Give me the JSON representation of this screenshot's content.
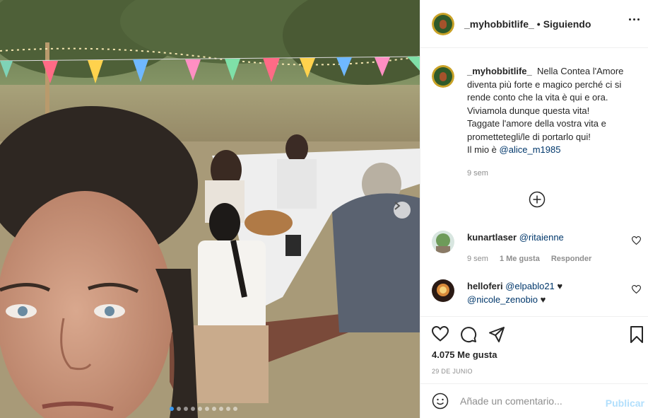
{
  "post": {
    "username": "_myhobbitlife_",
    "separator": "•",
    "follow_status": "Siguiendo",
    "caption_username": "_myhobbitlife_",
    "caption_lines": [
      "Nella Contea l'Amore",
      "diventa più forte e magico perché ci si",
      "rende conto che la vita è qui e ora.",
      "Viviamola dunque questa vita!",
      "Taggate l'amore della vostra vita e",
      "promettetegli/le di portarlo qui!"
    ],
    "caption_mine_prefix": "Il mio è",
    "caption_mention": "@alice_m1985",
    "caption_time": "9 sem",
    "likes": "4.075 Me gusta",
    "date": "29 DE JUNIO"
  },
  "comments": [
    {
      "username": "kunartlaser",
      "mention": "@ritaienne",
      "time": "9 sem",
      "likes": "1 Me gusta",
      "reply": "Responder"
    },
    {
      "username": "helloferi",
      "mention": "@elpablo21",
      "heart": "♥",
      "mention2": "@nicole_zenobio",
      "heart2": "♥"
    }
  ],
  "composer": {
    "placeholder": "Añade un comentario...",
    "publish_label": "Publicar"
  },
  "icons": [
    "more-options-icon",
    "add-circle-icon",
    "heart-icon",
    "comment-icon",
    "share-icon",
    "bookmark-icon",
    "emoji-icon",
    "carousel-next-icon"
  ],
  "carousel": {
    "count": 10,
    "active_index": 0
  },
  "colors": {
    "link": "#00376b",
    "publish_disabled": "#b2dffc",
    "active_dot": "#3897f0",
    "muted": "#8e8e8e"
  }
}
